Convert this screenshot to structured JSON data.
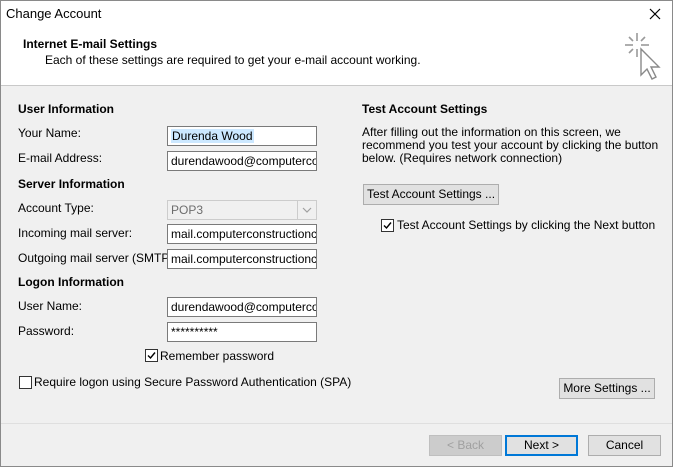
{
  "window": {
    "title": "Change Account"
  },
  "header": {
    "title": "Internet E-mail Settings",
    "subtitle": "Each of these settings are required to get your e-mail account working."
  },
  "user_info": {
    "section": "User Information",
    "name_label": "Your Name:",
    "name_value": "Durenda Wood",
    "email_label": "E-mail Address:",
    "email_value": "durendawood@computercons"
  },
  "server_info": {
    "section": "Server Information",
    "account_type_label": "Account Type:",
    "account_type_value": "POP3",
    "incoming_label": "Incoming mail server:",
    "incoming_value": "mail.computerconstructionco.c",
    "outgoing_label": "Outgoing mail server (SMTP):",
    "outgoing_value": "mail.computerconstructionco.c"
  },
  "logon_info": {
    "section": "Logon Information",
    "username_label": "User Name:",
    "username_value": "durendawood@computercons",
    "password_label": "Password:",
    "password_value": "**********",
    "remember_label": "Remember password",
    "remember_checked": true,
    "spa_label": "Require logon using Secure Password Authentication (SPA)",
    "spa_checked": false
  },
  "test_settings": {
    "section": "Test Account Settings",
    "desc_line1": "After filling out the information on this screen, we",
    "desc_line2": "recommend you test your account by clicking the button",
    "desc_line3": "below. (Requires network connection)",
    "test_button": "Test Account Settings ...",
    "auto_test_label": "Test Account Settings by clicking the Next button",
    "auto_test_checked": true
  },
  "more_settings_button": "More Settings ...",
  "footer": {
    "back_label": "< Back",
    "next_label": "Next >",
    "cancel_label": "Cancel"
  },
  "icons": {
    "close": "close-icon",
    "wizard": "wizard-sparkle-cursor-icon",
    "dropdown": "chevron-down-icon",
    "check": "checkmark-icon"
  },
  "colors": {
    "selection": "#cce8ff",
    "default_button_border": "#0078d7",
    "dialog_bg": "#f0f0f0"
  }
}
